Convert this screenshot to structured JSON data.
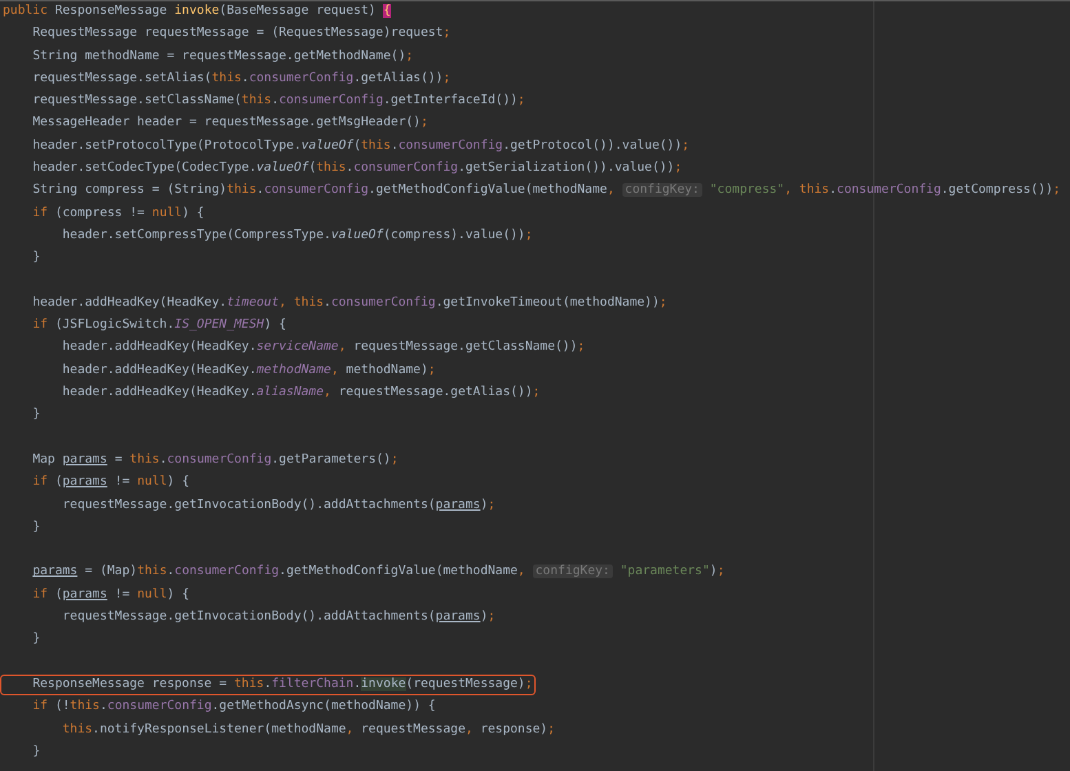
{
  "editor": {
    "blocks": [
      {
        "lines": [
          {
            "highlighted": false,
            "tokens": [
              {
                "text": "public",
                "kind": "keyword"
              },
              {
                "text": " ResponseMessage ",
                "kind": "plain"
              },
              {
                "text": "invoke",
                "kind": "declaration"
              },
              {
                "text": "(BaseMessage request) ",
                "kind": "plain"
              },
              {
                "text": "{",
                "kind": "brace-match"
              }
            ]
          },
          {
            "highlighted": false,
            "tokens": [
              {
                "text": "    RequestMessage requestMessage = (RequestMessage)request",
                "kind": "plain"
              },
              {
                "text": ";",
                "kind": "keyword"
              }
            ]
          },
          {
            "highlighted": false,
            "tokens": [
              {
                "text": "    String methodName = requestMessage.getMethodName()",
                "kind": "plain"
              },
              {
                "text": ";",
                "kind": "keyword"
              }
            ]
          },
          {
            "highlighted": false,
            "tokens": [
              {
                "text": "    requestMessage.setAlias(",
                "kind": "plain"
              },
              {
                "text": "this",
                "kind": "keyword"
              },
              {
                "text": ".",
                "kind": "plain"
              },
              {
                "text": "consumerConfig",
                "kind": "field"
              },
              {
                "text": ".getAlias())",
                "kind": "plain"
              },
              {
                "text": ";",
                "kind": "keyword"
              }
            ]
          },
          {
            "highlighted": false,
            "tokens": [
              {
                "text": "    requestMessage.setClassName(",
                "kind": "plain"
              },
              {
                "text": "this",
                "kind": "keyword"
              },
              {
                "text": ".",
                "kind": "plain"
              },
              {
                "text": "consumerConfig",
                "kind": "field"
              },
              {
                "text": ".getInterfaceId())",
                "kind": "plain"
              },
              {
                "text": ";",
                "kind": "keyword"
              }
            ]
          },
          {
            "highlighted": false,
            "tokens": [
              {
                "text": "    MessageHeader header = requestMessage.getMsgHeader()",
                "kind": "plain"
              },
              {
                "text": ";",
                "kind": "keyword"
              }
            ]
          },
          {
            "highlighted": false,
            "tokens": [
              {
                "text": "    header.setProtocolType(ProtocolType.",
                "kind": "plain"
              },
              {
                "text": "valueOf",
                "kind": "static"
              },
              {
                "text": "(",
                "kind": "plain"
              },
              {
                "text": "this",
                "kind": "keyword"
              },
              {
                "text": ".",
                "kind": "plain"
              },
              {
                "text": "consumerConfig",
                "kind": "field"
              },
              {
                "text": ".getProtocol()).value())",
                "kind": "plain"
              },
              {
                "text": ";",
                "kind": "keyword"
              }
            ]
          },
          {
            "highlighted": false,
            "tokens": [
              {
                "text": "    header.setCodecType(CodecType.",
                "kind": "plain"
              },
              {
                "text": "valueOf",
                "kind": "static"
              },
              {
                "text": "(",
                "kind": "plain"
              },
              {
                "text": "this",
                "kind": "keyword"
              },
              {
                "text": ".",
                "kind": "plain"
              },
              {
                "text": "consumerConfig",
                "kind": "field"
              },
              {
                "text": ".getSerialization()).value())",
                "kind": "plain"
              },
              {
                "text": ";",
                "kind": "keyword"
              }
            ]
          },
          {
            "highlighted": false,
            "tokens": [
              {
                "text": "    String compress = (String)",
                "kind": "plain"
              },
              {
                "text": "this",
                "kind": "keyword"
              },
              {
                "text": ".",
                "kind": "plain"
              },
              {
                "text": "consumerConfig",
                "kind": "field"
              },
              {
                "text": ".getMethodConfigValue(methodName",
                "kind": "plain"
              },
              {
                "text": ", ",
                "kind": "keyword"
              },
              {
                "text": "configKey:",
                "kind": "hint"
              },
              {
                "text": " \"compress\"",
                "kind": "string"
              },
              {
                "text": ", ",
                "kind": "keyword"
              },
              {
                "text": "this",
                "kind": "keyword"
              },
              {
                "text": ".",
                "kind": "plain"
              },
              {
                "text": "consumerConfig",
                "kind": "field"
              },
              {
                "text": ".getCompress())",
                "kind": "plain"
              },
              {
                "text": ";",
                "kind": "keyword"
              }
            ]
          },
          {
            "highlighted": false,
            "tokens": [
              {
                "text": "    if",
                "kind": "keyword"
              },
              {
                "text": " (compress != ",
                "kind": "plain"
              },
              {
                "text": "null",
                "kind": "keyword"
              },
              {
                "text": ") {",
                "kind": "plain"
              }
            ]
          },
          {
            "highlighted": false,
            "tokens": [
              {
                "text": "        header.setCompressType(CompressType.",
                "kind": "plain"
              },
              {
                "text": "valueOf",
                "kind": "static"
              },
              {
                "text": "(compress).value())",
                "kind": "plain"
              },
              {
                "text": ";",
                "kind": "keyword"
              }
            ]
          },
          {
            "highlighted": false,
            "tokens": [
              {
                "text": "    }",
                "kind": "plain"
              }
            ]
          }
        ]
      },
      {
        "lines": [
          {
            "highlighted": false,
            "tokens": [
              {
                "text": "    header.addHeadKey(HeadKey.",
                "kind": "plain"
              },
              {
                "text": "timeout",
                "kind": "static-field"
              },
              {
                "text": ", ",
                "kind": "keyword"
              },
              {
                "text": "this",
                "kind": "keyword"
              },
              {
                "text": ".",
                "kind": "plain"
              },
              {
                "text": "consumerConfig",
                "kind": "field"
              },
              {
                "text": ".getInvokeTimeout(methodName))",
                "kind": "plain"
              },
              {
                "text": ";",
                "kind": "keyword"
              }
            ]
          },
          {
            "highlighted": false,
            "tokens": [
              {
                "text": "    if",
                "kind": "keyword"
              },
              {
                "text": " (JSFLogicSwitch.",
                "kind": "plain"
              },
              {
                "text": "IS_OPEN_MESH",
                "kind": "static-field"
              },
              {
                "text": ") {",
                "kind": "plain"
              }
            ]
          },
          {
            "highlighted": false,
            "tokens": [
              {
                "text": "        header.addHeadKey(HeadKey.",
                "kind": "plain"
              },
              {
                "text": "serviceName",
                "kind": "static-field"
              },
              {
                "text": ", ",
                "kind": "keyword"
              },
              {
                "text": "requestMessage.getClassName())",
                "kind": "plain"
              },
              {
                "text": ";",
                "kind": "keyword"
              }
            ]
          },
          {
            "highlighted": false,
            "tokens": [
              {
                "text": "        header.addHeadKey(HeadKey.",
                "kind": "plain"
              },
              {
                "text": "methodName",
                "kind": "static-field"
              },
              {
                "text": ", ",
                "kind": "keyword"
              },
              {
                "text": "methodName)",
                "kind": "plain"
              },
              {
                "text": ";",
                "kind": "keyword"
              }
            ]
          },
          {
            "highlighted": false,
            "tokens": [
              {
                "text": "        header.addHeadKey(HeadKey.",
                "kind": "plain"
              },
              {
                "text": "aliasName",
                "kind": "static-field"
              },
              {
                "text": ", ",
                "kind": "keyword"
              },
              {
                "text": "requestMessage.getAlias())",
                "kind": "plain"
              },
              {
                "text": ";",
                "kind": "keyword"
              }
            ]
          },
          {
            "highlighted": false,
            "tokens": [
              {
                "text": "    }",
                "kind": "plain"
              }
            ]
          }
        ]
      },
      {
        "lines": [
          {
            "highlighted": false,
            "tokens": [
              {
                "text": "    Map ",
                "kind": "plain"
              },
              {
                "text": "params",
                "kind": "reassigned"
              },
              {
                "text": " = ",
                "kind": "plain"
              },
              {
                "text": "this",
                "kind": "keyword"
              },
              {
                "text": ".",
                "kind": "plain"
              },
              {
                "text": "consumerConfig",
                "kind": "field"
              },
              {
                "text": ".getParameters()",
                "kind": "plain"
              },
              {
                "text": ";",
                "kind": "keyword"
              }
            ]
          },
          {
            "highlighted": false,
            "tokens": [
              {
                "text": "    if",
                "kind": "keyword"
              },
              {
                "text": " (",
                "kind": "plain"
              },
              {
                "text": "params",
                "kind": "reassigned"
              },
              {
                "text": " != ",
                "kind": "plain"
              },
              {
                "text": "null",
                "kind": "keyword"
              },
              {
                "text": ") {",
                "kind": "plain"
              }
            ]
          },
          {
            "highlighted": false,
            "tokens": [
              {
                "text": "        requestMessage.getInvocationBody().addAttachments(",
                "kind": "plain"
              },
              {
                "text": "params",
                "kind": "reassigned"
              },
              {
                "text": ")",
                "kind": "plain"
              },
              {
                "text": ";",
                "kind": "keyword"
              }
            ]
          },
          {
            "highlighted": false,
            "tokens": [
              {
                "text": "    }",
                "kind": "plain"
              }
            ]
          }
        ]
      },
      {
        "lines": [
          {
            "highlighted": false,
            "tokens": [
              {
                "text": "    params",
                "kind": "reassigned"
              },
              {
                "text": " = (Map)",
                "kind": "plain"
              },
              {
                "text": "this",
                "kind": "keyword"
              },
              {
                "text": ".",
                "kind": "plain"
              },
              {
                "text": "consumerConfig",
                "kind": "field"
              },
              {
                "text": ".getMethodConfigValue(methodName",
                "kind": "plain"
              },
              {
                "text": ", ",
                "kind": "keyword"
              },
              {
                "text": "configKey:",
                "kind": "hint"
              },
              {
                "text": " \"parameters\"",
                "kind": "string"
              },
              {
                "text": ")",
                "kind": "plain"
              },
              {
                "text": ";",
                "kind": "keyword"
              }
            ]
          },
          {
            "highlighted": false,
            "tokens": [
              {
                "text": "    if",
                "kind": "keyword"
              },
              {
                "text": " (",
                "kind": "plain"
              },
              {
                "text": "params",
                "kind": "reassigned"
              },
              {
                "text": " != ",
                "kind": "plain"
              },
              {
                "text": "null",
                "kind": "keyword"
              },
              {
                "text": ") {",
                "kind": "plain"
              }
            ]
          },
          {
            "highlighted": false,
            "tokens": [
              {
                "text": "        requestMessage.getInvocationBody().addAttachments(",
                "kind": "plain"
              },
              {
                "text": "params",
                "kind": "reassigned"
              },
              {
                "text": ")",
                "kind": "plain"
              },
              {
                "text": ";",
                "kind": "keyword"
              }
            ]
          },
          {
            "highlighted": false,
            "tokens": [
              {
                "text": "    }",
                "kind": "plain"
              }
            ]
          }
        ]
      },
      {
        "lines": [
          {
            "highlighted": true,
            "tokens": [
              {
                "text": "    ResponseMessage response = ",
                "kind": "plain"
              },
              {
                "text": "this",
                "kind": "keyword"
              },
              {
                "text": ".",
                "kind": "plain"
              },
              {
                "text": "filterChain",
                "kind": "field"
              },
              {
                "text": ".",
                "kind": "plain"
              },
              {
                "text": "invoke",
                "kind": "usage"
              },
              {
                "text": "(requestMessage)",
                "kind": "plain"
              },
              {
                "text": ";",
                "kind": "keyword"
              }
            ]
          },
          {
            "highlighted": false,
            "tokens": [
              {
                "text": "    if",
                "kind": "keyword"
              },
              {
                "text": " (!",
                "kind": "plain"
              },
              {
                "text": "this",
                "kind": "keyword"
              },
              {
                "text": ".consumerConfig",
                "kind": "member"
              },
              {
                "text": ".getMethodAsync(methodName)) {",
                "kind": "plain"
              }
            ]
          },
          {
            "highlighted": false,
            "tokens": [
              {
                "text": "        this",
                "kind": "keyword"
              },
              {
                "text": ".notifyResponseListener(methodName",
                "kind": "plain"
              },
              {
                "text": ", ",
                "kind": "keyword"
              },
              {
                "text": "requestMessage",
                "kind": "plain"
              },
              {
                "text": ", ",
                "kind": "keyword"
              },
              {
                "text": "response)",
                "kind": "plain"
              },
              {
                "text": ";",
                "kind": "keyword"
              }
            ]
          },
          {
            "highlighted": false,
            "tokens": [
              {
                "text": "    }",
                "kind": "plain"
              }
            ]
          }
        ]
      }
    ]
  }
}
